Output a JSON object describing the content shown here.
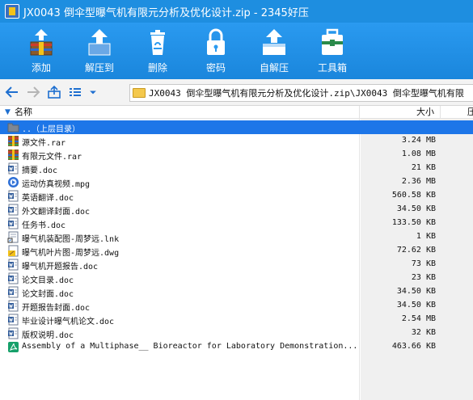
{
  "window": {
    "title": "JX0043 倒伞型曝气机有限元分析及优化设计.zip - 2345好压",
    "accent": "#1e8ee0"
  },
  "toolbar": {
    "items": [
      {
        "label": "添加",
        "icon": "add-archive-icon"
      },
      {
        "label": "解压到",
        "icon": "extract-icon"
      },
      {
        "label": "删除",
        "icon": "delete-icon"
      },
      {
        "label": "密码",
        "icon": "lock-icon"
      },
      {
        "label": "自解压",
        "icon": "self-extract-icon"
      },
      {
        "label": "工具箱",
        "icon": "toolbox-icon"
      }
    ]
  },
  "address": {
    "path": "JX0043 倒伞型曝气机有限元分析及优化设计.zip\\JX0043 倒伞型曝气机有限"
  },
  "columns": {
    "name": "名称",
    "size": "大小",
    "packed": "压"
  },
  "files": [
    {
      "name": "..（上层目录）",
      "size": "",
      "type": "parent-folder",
      "selected": true
    },
    {
      "name": "源文件.rar",
      "size": "3.24 MB",
      "type": "rar"
    },
    {
      "name": "有限元文件.rar",
      "size": "1.08 MB",
      "type": "rar"
    },
    {
      "name": "摘要.doc",
      "size": "21 KB",
      "type": "doc"
    },
    {
      "name": "运动仿真视频.mpg",
      "size": "2.36 MB",
      "type": "video"
    },
    {
      "name": "英语翻译.doc",
      "size": "560.58 KB",
      "type": "doc"
    },
    {
      "name": "外文翻译封面.doc",
      "size": "34.50 KB",
      "type": "doc"
    },
    {
      "name": "任务书.doc",
      "size": "133.50 KB",
      "type": "doc"
    },
    {
      "name": "曝气机装配图-周梦远.lnk",
      "size": "1 KB",
      "type": "lnk"
    },
    {
      "name": "曝气机叶片图-周梦远.dwg",
      "size": "72.62 KB",
      "type": "dwg"
    },
    {
      "name": "曝气机开题报告.doc",
      "size": "73 KB",
      "type": "doc"
    },
    {
      "name": "论文目录.doc",
      "size": "23 KB",
      "type": "doc"
    },
    {
      "name": "论文封面.doc",
      "size": "34.50 KB",
      "type": "doc"
    },
    {
      "name": "开题报告封面.doc",
      "size": "34.50 KB",
      "type": "doc"
    },
    {
      "name": "毕业设计曝气机论文.doc",
      "size": "2.54 MB",
      "type": "doc"
    },
    {
      "name": "版权说明.doc",
      "size": "32 KB",
      "type": "doc"
    },
    {
      "name": "Assembly of a Multiphase__ Bioreactor for Laboratory Demonstration...",
      "size": "463.66 KB",
      "type": "pdf"
    }
  ]
}
